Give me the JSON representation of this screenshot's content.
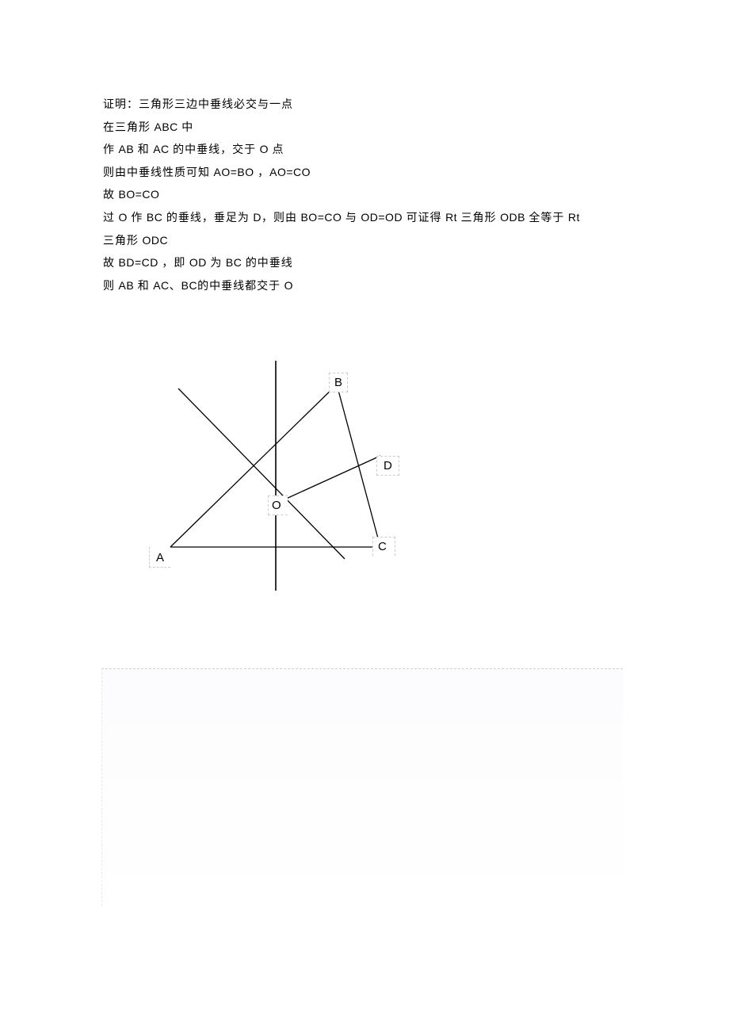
{
  "proof": {
    "line1": "证明：三角形三边中垂线必交与一点",
    "line2_pre": "在三角形 ",
    "line2_abc": "ABC",
    "line2_post": " 中",
    "line3_pre": "作 ",
    "line3_ab": "AB",
    "line3_mid1": " 和 ",
    "line3_ac": "AC",
    "line3_mid2": " 的中垂线，交于   ",
    "line3_o": "O",
    "line3_post": " 点",
    "line4_pre": "则由中垂线性质可知    ",
    "line4_eq1": "AO=BO",
    "line4_comma": " ，",
    "line4_eq2": "AO=CO",
    "line5_pre": "故 ",
    "line5_eq": "BO=CO",
    "line6_pre": "过 ",
    "line6_o": "O",
    "line6_t1": " 作 ",
    "line6_bc": "BC",
    "line6_t2": " 的垂线，垂足为    ",
    "line6_d": "D",
    "line6_t3": "，则由 ",
    "line6_eq1": "BO=CO",
    "line6_t4": "  与 ",
    "line6_eq2": "OD=OD",
    "line6_t5": "  可证得  ",
    "line6_rt1": "Rt",
    "line6_t6": " 三角形 ",
    "line6_odb": "ODB",
    "line6_t7": " 全等于 ",
    "line6_rt2": "Rt",
    "line7_pre": "三角形  ",
    "line7_odc": "ODC",
    "line8_pre": "故 ",
    "line8_eq": "BD=CD",
    "line8_t1": " ，即 ",
    "line8_od": "OD",
    "line8_t2": " 为 ",
    "line8_bc": "BC",
    "line8_t3": " 的中垂线",
    "line9_pre": "则 ",
    "line9_ab": "AB",
    "line9_t1": " 和 ",
    "line9_ac": "AC",
    "line9_t2": "、",
    "line9_bc": "BC",
    "line9_t3": "的中垂线都交于    ",
    "line9_o": "O"
  },
  "labels": {
    "A": "A",
    "B": "B",
    "C": "C",
    "D": "D",
    "O": "O"
  }
}
